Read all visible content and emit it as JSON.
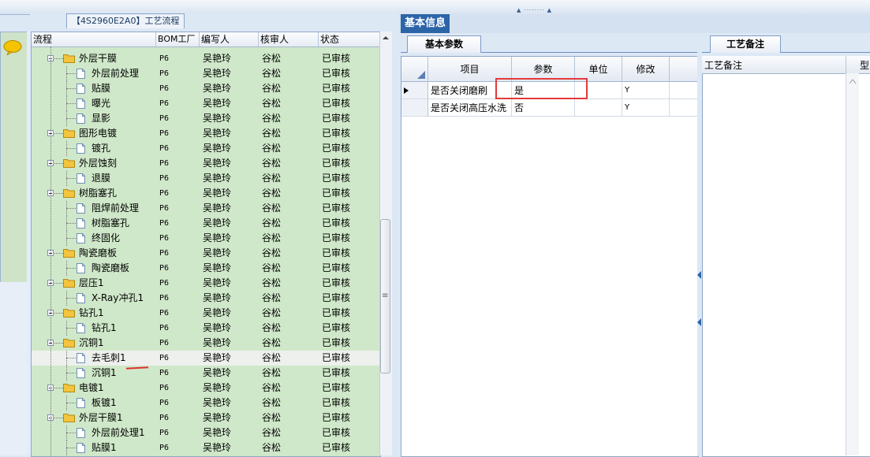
{
  "window": {
    "left_title": "【4S2960E2A0】工艺流程",
    "center_title": "基本信息"
  },
  "tree": {
    "columns": [
      "流程",
      "BOM工厂",
      "编写人",
      "核审人",
      "状态"
    ],
    "rows": [
      {
        "label": "外层干膜",
        "type": "folder",
        "level": 1,
        "bom": "P6",
        "editor": "吴艳玲",
        "reviewer": "谷松",
        "status": "已审核"
      },
      {
        "label": "外层前处理",
        "type": "file",
        "level": 2,
        "bom": "P6",
        "editor": "吴艳玲",
        "reviewer": "谷松",
        "status": "已审核"
      },
      {
        "label": "贴膜",
        "type": "file",
        "level": 2,
        "bom": "P6",
        "editor": "吴艳玲",
        "reviewer": "谷松",
        "status": "已审核"
      },
      {
        "label": "曝光",
        "type": "file",
        "level": 2,
        "bom": "P6",
        "editor": "吴艳玲",
        "reviewer": "谷松",
        "status": "已审核"
      },
      {
        "label": "显影",
        "type": "file",
        "level": 2,
        "bom": "P6",
        "editor": "吴艳玲",
        "reviewer": "谷松",
        "status": "已审核"
      },
      {
        "label": "图形电镀",
        "type": "folder",
        "level": 1,
        "bom": "P6",
        "editor": "吴艳玲",
        "reviewer": "谷松",
        "status": "已审核"
      },
      {
        "label": "镀孔",
        "type": "file",
        "level": 2,
        "bom": "P6",
        "editor": "吴艳玲",
        "reviewer": "谷松",
        "status": "已审核"
      },
      {
        "label": "外层蚀刻",
        "type": "folder",
        "level": 1,
        "bom": "P6",
        "editor": "吴艳玲",
        "reviewer": "谷松",
        "status": "已审核"
      },
      {
        "label": "退膜",
        "type": "file",
        "level": 2,
        "bom": "P6",
        "editor": "吴艳玲",
        "reviewer": "谷松",
        "status": "已审核"
      },
      {
        "label": "树脂塞孔",
        "type": "folder",
        "level": 1,
        "bom": "P6",
        "editor": "吴艳玲",
        "reviewer": "谷松",
        "status": "已审核"
      },
      {
        "label": "阻焊前处理",
        "type": "file",
        "level": 2,
        "bom": "P6",
        "editor": "吴艳玲",
        "reviewer": "谷松",
        "status": "已审核"
      },
      {
        "label": "树脂塞孔",
        "type": "file",
        "level": 2,
        "bom": "P6",
        "editor": "吴艳玲",
        "reviewer": "谷松",
        "status": "已审核"
      },
      {
        "label": "终固化",
        "type": "file",
        "level": 2,
        "bom": "P6",
        "editor": "吴艳玲",
        "reviewer": "谷松",
        "status": "已审核"
      },
      {
        "label": "陶瓷磨板",
        "type": "folder",
        "level": 1,
        "bom": "P6",
        "editor": "吴艳玲",
        "reviewer": "谷松",
        "status": "已审核"
      },
      {
        "label": "陶瓷磨板",
        "type": "file",
        "level": 2,
        "bom": "P6",
        "editor": "吴艳玲",
        "reviewer": "谷松",
        "status": "已审核"
      },
      {
        "label": "层压1",
        "type": "folder",
        "level": 1,
        "bom": "P6",
        "editor": "吴艳玲",
        "reviewer": "谷松",
        "status": "已审核"
      },
      {
        "label": "X-Ray冲孔1",
        "type": "file",
        "level": 2,
        "bom": "P6",
        "editor": "吴艳玲",
        "reviewer": "谷松",
        "status": "已审核"
      },
      {
        "label": "钻孔1",
        "type": "folder",
        "level": 1,
        "bom": "P6",
        "editor": "吴艳玲",
        "reviewer": "谷松",
        "status": "已审核"
      },
      {
        "label": "钻孔1",
        "type": "file",
        "level": 2,
        "bom": "P6",
        "editor": "吴艳玲",
        "reviewer": "谷松",
        "status": "已审核"
      },
      {
        "label": "沉铜1",
        "type": "folder",
        "level": 1,
        "bom": "P6",
        "editor": "吴艳玲",
        "reviewer": "谷松",
        "status": "已审核"
      },
      {
        "label": "去毛刺1",
        "type": "file",
        "level": 2,
        "bom": "P6",
        "editor": "吴艳玲",
        "reviewer": "谷松",
        "status": "已审核",
        "selected": true
      },
      {
        "label": "沉铜1",
        "type": "file",
        "level": 2,
        "bom": "P6",
        "editor": "吴艳玲",
        "reviewer": "谷松",
        "status": "已审核"
      },
      {
        "label": "电镀1",
        "type": "folder",
        "level": 1,
        "bom": "P6",
        "editor": "吴艳玲",
        "reviewer": "谷松",
        "status": "已审核"
      },
      {
        "label": "板镀1",
        "type": "file",
        "level": 2,
        "bom": "P6",
        "editor": "吴艳玲",
        "reviewer": "谷松",
        "status": "已审核"
      },
      {
        "label": "外层干膜1",
        "type": "folder",
        "level": 1,
        "bom": "P6",
        "editor": "吴艳玲",
        "reviewer": "谷松",
        "status": "已审核"
      },
      {
        "label": "外层前处理1",
        "type": "file",
        "level": 2,
        "bom": "P6",
        "editor": "吴艳玲",
        "reviewer": "谷松",
        "status": "已审核"
      },
      {
        "label": "贴膜1",
        "type": "file",
        "level": 2,
        "bom": "P6",
        "editor": "吴艳玲",
        "reviewer": "谷松",
        "status": "已审核"
      }
    ]
  },
  "params": {
    "tab": "基本参数",
    "columns": [
      "项目",
      "参数",
      "单位",
      "修改"
    ],
    "rows": [
      {
        "item": "是否关闭磨刷",
        "value": "是",
        "unit": "",
        "modified": "Y"
      },
      {
        "item": "是否关闭高压水洗",
        "value": "否",
        "unit": "",
        "modified": "Y"
      }
    ]
  },
  "notes": {
    "tab": "工艺备注",
    "column": "工艺备注",
    "column2": "型"
  },
  "colors": {
    "tree_bg": "#cfe8c9",
    "title_blue": "#2c64a8",
    "annotation_red": "#e23a3a"
  }
}
